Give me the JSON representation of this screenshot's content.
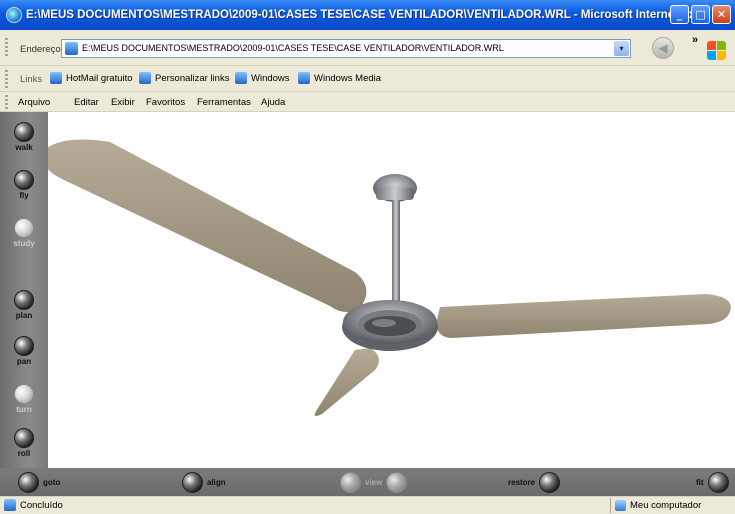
{
  "window": {
    "title": "E:\\MEUS DOCUMENTOS\\MESTRADO\\2009-01\\CASES TESE\\CASE VENTILADOR\\VENTILADOR.WRL - Microsoft Internet Explorer",
    "min_glyph": "_",
    "max_glyph": "□",
    "close_glyph": "✕"
  },
  "address": {
    "label": "Endereço",
    "value": "E:\\MEUS DOCUMENTOS\\MESTRADO\\2009-01\\CASES TESE\\CASE VENTILADOR\\VENTILADOR.WRL",
    "dropdown_glyph": "▾",
    "back_glyph": "◀",
    "chevron": "»"
  },
  "links": {
    "label": "Links",
    "items": [
      "HotMail gratuito",
      "Personalizar links",
      "Windows",
      "Windows Media"
    ]
  },
  "menu": [
    "Arquivo",
    "Editar",
    "Exibir",
    "Favoritos",
    "Ferramentas",
    "Ajuda"
  ],
  "viewer": {
    "left_tools": [
      "walk",
      "fly",
      "study",
      "plan",
      "pan",
      "turn",
      "roll"
    ],
    "bottom_tools": {
      "goto": "goto",
      "align": "align",
      "view": "view",
      "restore": "restore",
      "fit": "fit"
    },
    "blade_color": "#a89c86",
    "metal_color": "#8e9296"
  },
  "status": {
    "text": "Concluído",
    "zone": "Meu computador"
  }
}
